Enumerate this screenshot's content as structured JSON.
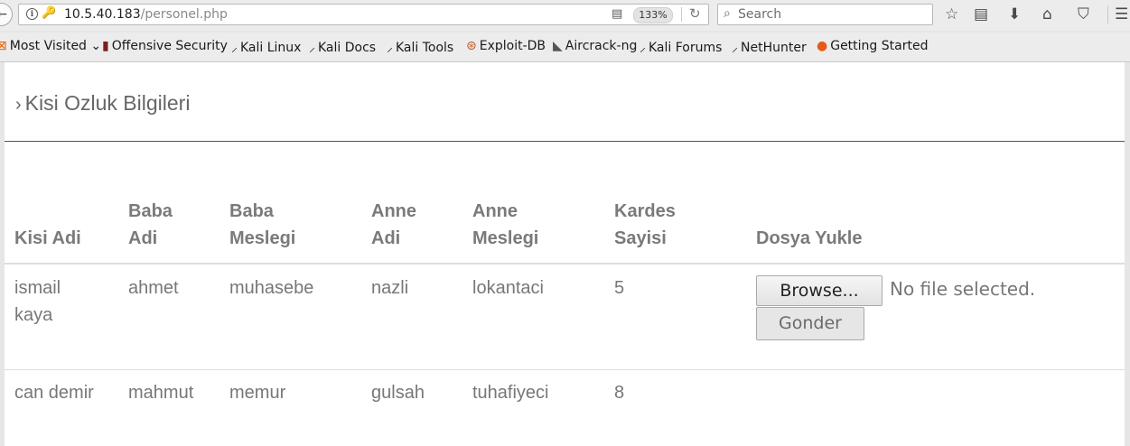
{
  "browser": {
    "url_host": "10.5.40.183",
    "url_path": "/personel.php",
    "zoom": "133%",
    "search_placeholder": "Search"
  },
  "bookmarks": [
    {
      "label": "Most Visited",
      "icon": "rss-icon"
    },
    {
      "label": "Offensive Security",
      "icon": "offsec-icon"
    },
    {
      "label": "Kali Linux",
      "icon": "kali-icon"
    },
    {
      "label": "Kali Docs",
      "icon": "kali-icon"
    },
    {
      "label": "Kali Tools",
      "icon": "kali-icon"
    },
    {
      "label": "Exploit-DB",
      "icon": "exploitdb-icon"
    },
    {
      "label": "Aircrack-ng",
      "icon": "aircrack-icon"
    },
    {
      "label": "Kali Forums",
      "icon": "kali-icon"
    },
    {
      "label": "NetHunter",
      "icon": "kali-icon"
    },
    {
      "label": "Getting Started",
      "icon": "firefox-icon"
    }
  ],
  "page": {
    "section_title": "Kisi Ozluk Bilgileri",
    "headers": {
      "kisi_adi": "Kisi Adi",
      "baba_adi_1": "Baba",
      "baba_adi_2": "Adi",
      "baba_meslegi_1": "Baba",
      "baba_meslegi_2": "Meslegi",
      "anne_adi_1": "Anne",
      "anne_adi_2": "Adi",
      "anne_meslegi_1": "Anne",
      "anne_meslegi_2": "Meslegi",
      "kardes_sayisi_1": "Kardes",
      "kardes_sayisi_2": "Sayisi",
      "dosya_yukle": "Dosya Yukle"
    },
    "rows": [
      {
        "kisi_adi_1": "ismail",
        "kisi_adi_2": "kaya",
        "baba_adi": "ahmet",
        "baba_meslegi": "muhasebe",
        "anne_adi": "nazli",
        "anne_meslegi": "lokantaci",
        "kardes_sayisi": "5"
      },
      {
        "kisi_adi": "can demir",
        "baba_adi": "mahmut",
        "baba_meslegi": "memur",
        "anne_adi": "gulsah",
        "anne_meslegi": "tuhafiyeci",
        "kardes_sayisi": "8"
      }
    ],
    "upload": {
      "browse_label": "Browse...",
      "no_file": "No file selected.",
      "submit_label": "Gonder"
    }
  }
}
